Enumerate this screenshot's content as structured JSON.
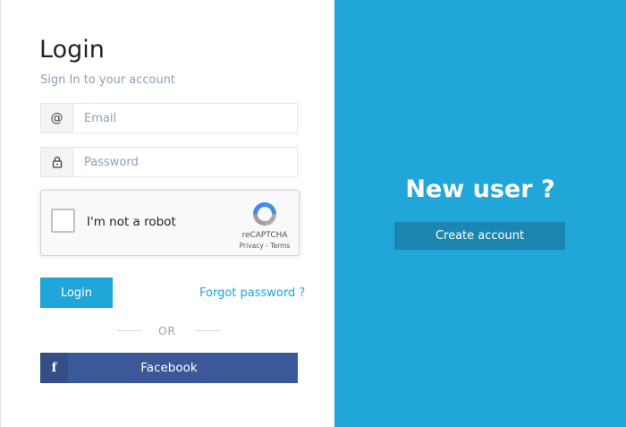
{
  "login": {
    "title": "Login",
    "subtitle": "Sign In to your account",
    "email": {
      "icon_text": "@",
      "icon": "at-icon",
      "placeholder": "Email",
      "value": ""
    },
    "password": {
      "icon": "lock-icon",
      "placeholder": "Password",
      "value": ""
    },
    "captcha": {
      "label": "I'm not a robot",
      "brand": "reCAPTCHA",
      "links": "Privacy - Terms",
      "checked": false
    },
    "login_button": "Login",
    "forgot_link": "Forgot password ?",
    "divider_text": "OR",
    "facebook": {
      "icon_text": "f",
      "label": "Facebook",
      "color": "#3b5998"
    }
  },
  "register": {
    "heading": "New user ?",
    "button": "Create account"
  },
  "colors": {
    "accent": "#21a6da",
    "accent_dark": "#1b86b0",
    "facebook": "#3b5998"
  }
}
